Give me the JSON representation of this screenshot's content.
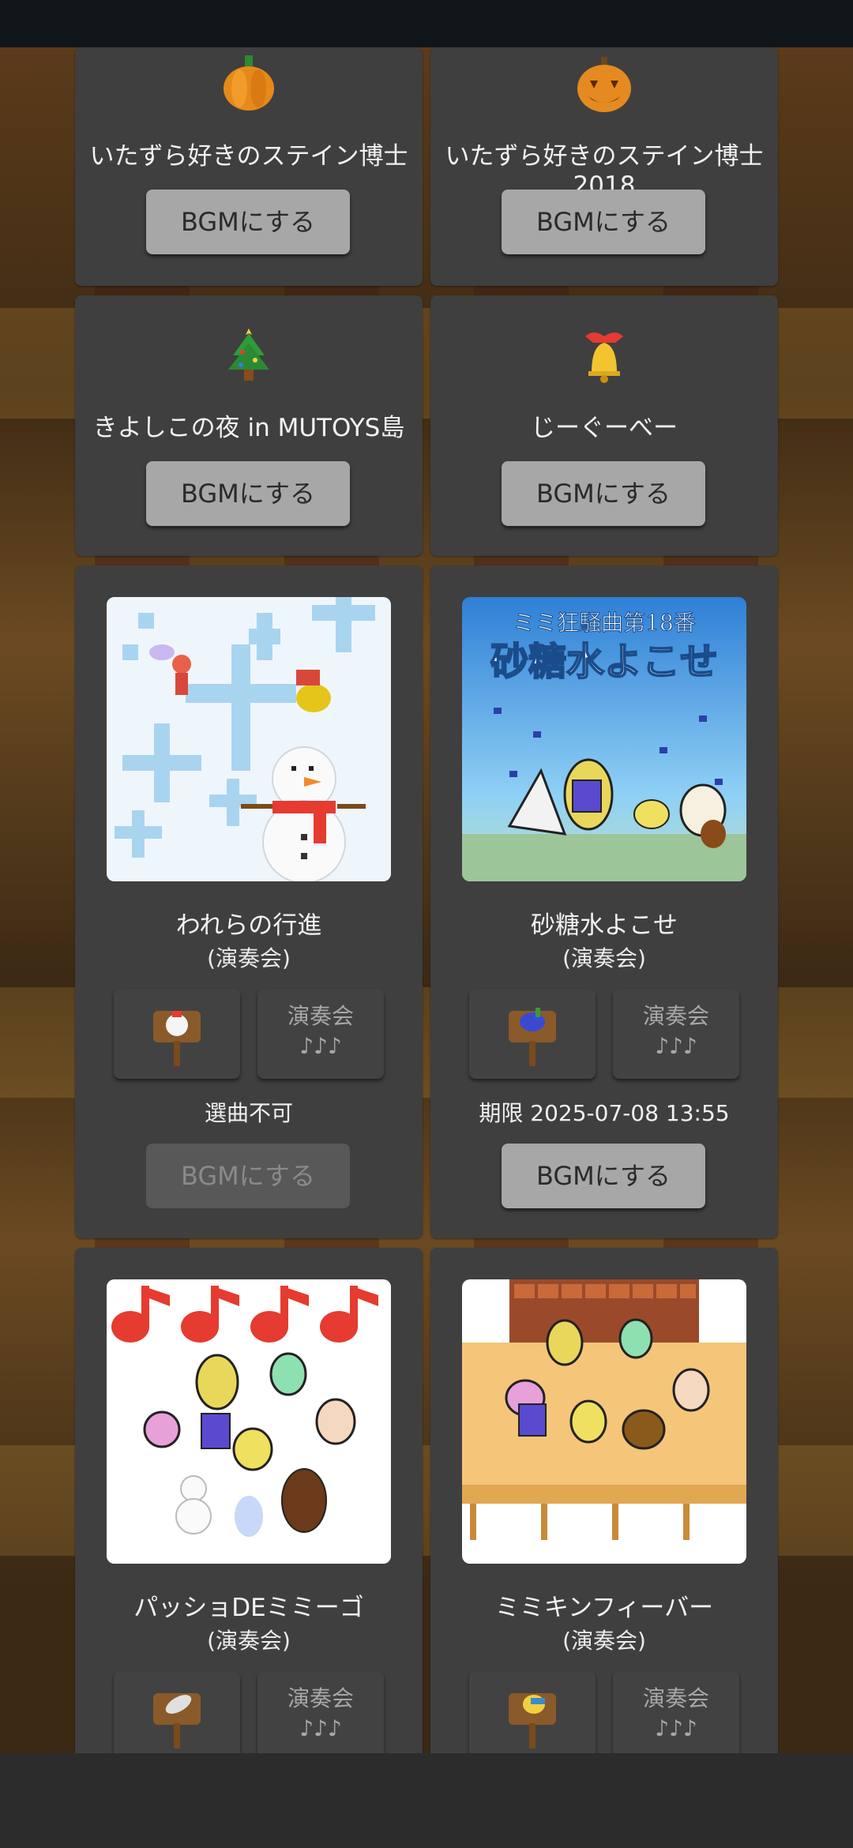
{
  "tracks": [
    {
      "title": "いたずら好きのステイン博士",
      "button": "BGMにする",
      "icon": "pepper-icon"
    },
    {
      "title": "いたずら好きのステイン博士2018",
      "button": "BGMにする",
      "icon": "jack-o-lantern-icon"
    },
    {
      "title": "きよしこの夜 in MUTOYS島",
      "button": "BGMにする",
      "icon": "christmas-tree-icon"
    },
    {
      "title": "じーぐーべー",
      "button": "BGMにする",
      "icon": "bell-icon"
    },
    {
      "title": "われらの行進",
      "subtitle": "(演奏会)",
      "slot_label": "演奏会",
      "slot_notes": "♪♪♪",
      "status": "選曲不可",
      "button": "BGMにする",
      "button_disabled": true,
      "cover": "snowman-cover",
      "stand_icon": "chicken-stand-icon"
    },
    {
      "title": "砂糖水よこせ",
      "subtitle": "(演奏会)",
      "slot_label": "演奏会",
      "slot_notes": "♪♪♪",
      "status": "期限 2025-07-08 13:55",
      "button": "BGMにする",
      "button_disabled": false,
      "cover": "sugar-water-cover",
      "cover_text_top": "ミミ狂騒曲第18番",
      "cover_text_main": "砂糖水よこせ",
      "stand_icon": "blue-bird-stand-icon"
    },
    {
      "title": "パッショDEミミーゴ",
      "subtitle": "(演奏会)",
      "slot_label": "演奏会",
      "slot_notes": "♪♪♪",
      "cover": "notes-band-cover",
      "stand_icon": "feather-stand-icon"
    },
    {
      "title": "ミミキンフィーバー",
      "subtitle": "(演奏会)",
      "slot_label": "演奏会",
      "slot_notes": "♪♪♪",
      "cover": "concert-hall-cover",
      "stand_icon": "yellow-bird-stand-icon"
    }
  ],
  "colors": {
    "card": "#3f3f3f",
    "button": "#a7a7a7",
    "button_disabled": "#585858",
    "accent_red": "#e53b30"
  }
}
